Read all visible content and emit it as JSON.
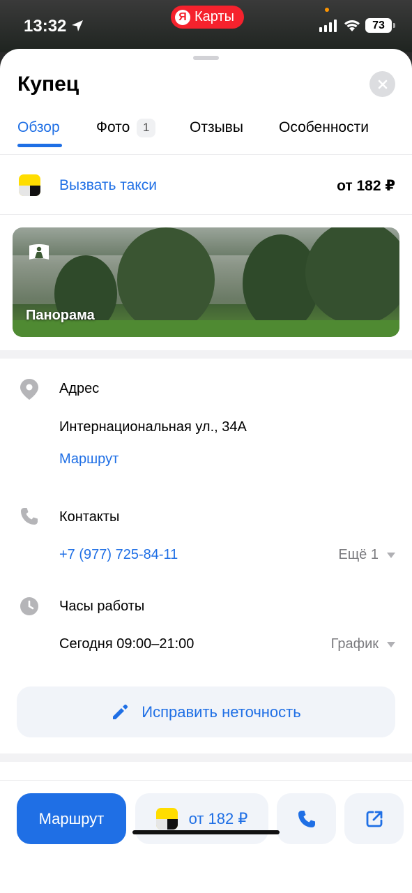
{
  "status_bar": {
    "time": "13:32",
    "app_pill": "Карты",
    "app_pill_logo": "Я",
    "battery": "73"
  },
  "place": {
    "title": "Купец"
  },
  "tabs": [
    {
      "label": "Обзор"
    },
    {
      "label": "Фото",
      "badge": "1"
    },
    {
      "label": "Отзывы"
    },
    {
      "label": "Особенности"
    }
  ],
  "taxi": {
    "label": "Вызвать такси",
    "price": "от 182 ₽"
  },
  "panorama": {
    "label": "Панорама"
  },
  "address": {
    "heading": "Адрес",
    "value": "Интернациональная ул., 34А",
    "route_link": "Маршрут"
  },
  "contacts": {
    "heading": "Контакты",
    "phone": "+7 (977) 725-84-11",
    "more": "Ещё 1"
  },
  "hours": {
    "heading": "Часы работы",
    "today": "Сегодня 09:00–21:00",
    "schedule": "График"
  },
  "fix": {
    "label": "Исправить неточность"
  },
  "bottom": {
    "route": "Маршрут",
    "taxi_price": "от 182 ₽"
  },
  "colors": {
    "accent": "#1f6fe5",
    "taxi_yellow": "#ffdd00",
    "pill_red": "#f5222d"
  },
  "icons": [
    "location-arrow-icon",
    "signal-icon",
    "wifi-icon",
    "close-icon",
    "panorama-icon",
    "pin-icon",
    "phone-icon",
    "clock-icon",
    "pencil-icon",
    "share-icon"
  ]
}
